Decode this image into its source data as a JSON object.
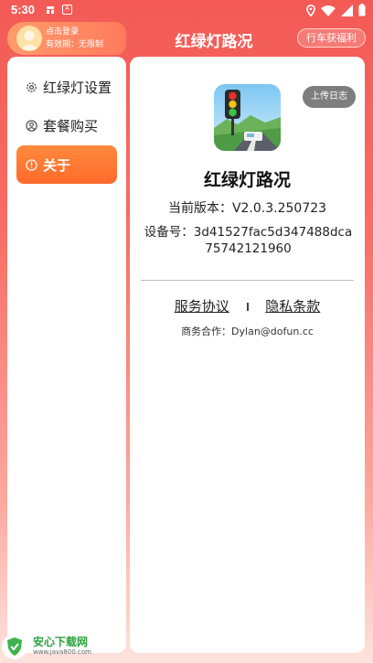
{
  "status_bar": {
    "time": "5:30",
    "notif_badge": "A"
  },
  "user": {
    "login_label": "点击登录",
    "validity_label": "有效期：无限制"
  },
  "header": {
    "title": "红绿灯路况",
    "welfare_button": "行车获福利"
  },
  "sidebar": {
    "items": [
      {
        "label": "红绿灯设置",
        "icon": "gear-icon",
        "active": false
      },
      {
        "label": "套餐购买",
        "icon": "user-circle-icon",
        "active": false
      },
      {
        "label": "关于",
        "icon": "info-icon",
        "active": true
      }
    ]
  },
  "about": {
    "upload_log_button": "上传日志",
    "app_name": "红绿灯路况",
    "version": "当前版本：V2.0.3.250723",
    "device_id": "设备号：3d41527fac5d347488dca75742121960",
    "service_agreement": "服务协议",
    "privacy_policy": "隐私条款",
    "business_contact": "商务合作：Dylan@dofun.cc"
  },
  "watermark": {
    "name": "安心下载网",
    "url": "www.java800.com"
  },
  "colors": {
    "header_red": "#f35a55",
    "active_orange": "#ff7a34",
    "log_button_gray": "#7e7e7e"
  }
}
